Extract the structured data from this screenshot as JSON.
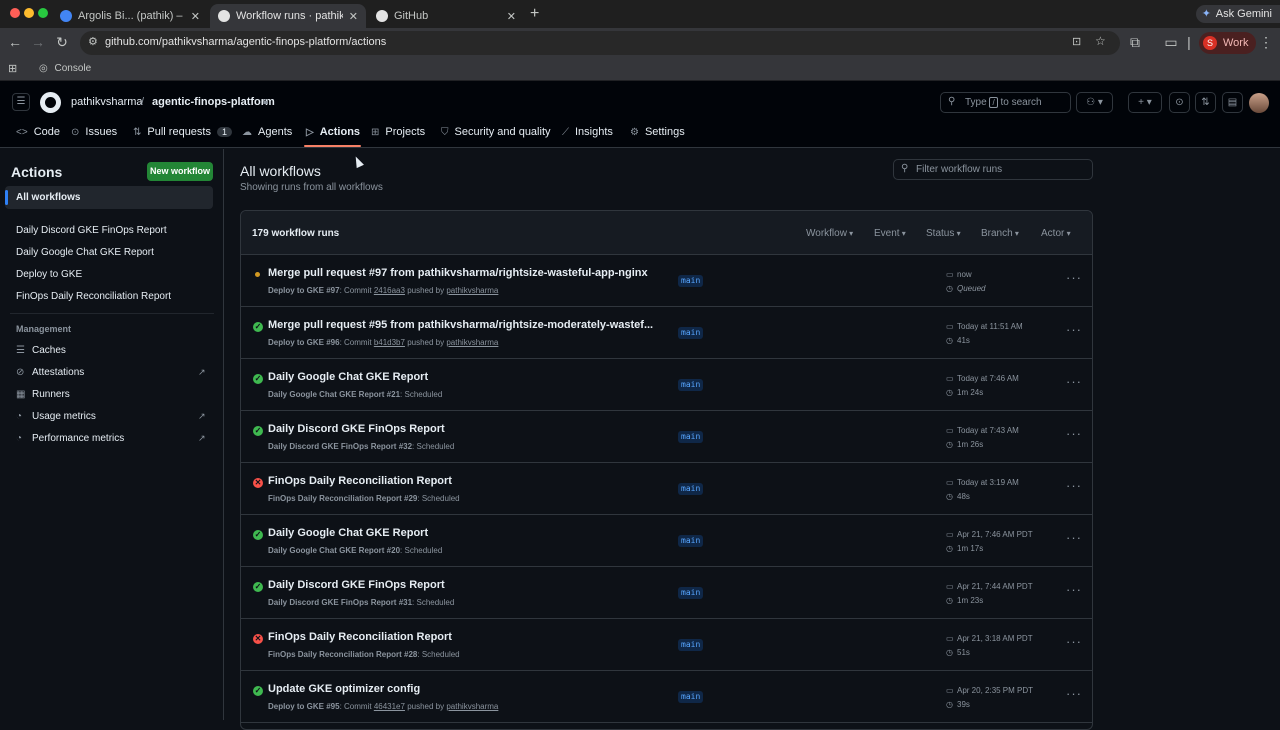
{
  "browser": {
    "tabs": [
      {
        "label": "Argolis Bi... (pathik) – Budget"
      },
      {
        "label": "Workflow runs · pathikvsharm"
      },
      {
        "label": "GitHub"
      }
    ],
    "new_tab": "+",
    "ask_gemini": "Ask Gemini",
    "url": "github.com/pathikvsharma/agentic-finops-platform/actions",
    "profile_initial": "S",
    "profile_label": "Work",
    "bookmarks": [
      {
        "label": "Console"
      }
    ],
    "colors": {
      "close": "#ff5f57",
      "minimize": "#febc2e",
      "zoom": "#28c840"
    }
  },
  "github": {
    "owner": "pathikvsharma",
    "separator": "/",
    "repo": "agentic-finops-platform",
    "search_prefix": "Type",
    "search_key": "/",
    "search_suffix": "to search",
    "nav": [
      {
        "label": "Code"
      },
      {
        "label": "Issues"
      },
      {
        "label": "Pull requests",
        "count": "1"
      },
      {
        "label": "Agents"
      },
      {
        "label": "Actions"
      },
      {
        "label": "Projects"
      },
      {
        "label": "Security and quality"
      },
      {
        "label": "Insights"
      },
      {
        "label": "Settings"
      }
    ]
  },
  "sidebar": {
    "title": "Actions",
    "new_workflow": "New workflow",
    "all_workflows": "All workflows",
    "workflows": [
      {
        "label": "Daily Discord GKE FinOps Report"
      },
      {
        "label": "Daily Google Chat GKE Report"
      },
      {
        "label": "Deploy to GKE"
      },
      {
        "label": "FinOps Daily Reconciliation Report"
      }
    ],
    "management_title": "Management",
    "management": [
      {
        "label": "Caches"
      },
      {
        "label": "Attestations"
      },
      {
        "label": "Runners"
      },
      {
        "label": "Usage metrics"
      },
      {
        "label": "Performance metrics"
      }
    ]
  },
  "main": {
    "title": "All workflows",
    "subtitle": "Showing runs from all workflows",
    "filter_placeholder": "Filter workflow runs",
    "runs_count": "179 workflow runs",
    "filters": [
      {
        "label": "Workflow"
      },
      {
        "label": "Event"
      },
      {
        "label": "Status"
      },
      {
        "label": "Branch"
      },
      {
        "label": "Actor"
      }
    ],
    "runs": [
      {
        "status": "queued",
        "title": "Merge pull request #97 from pathikvsharma/rightsize-wasteful-app-nginx",
        "workflow_run": "Deploy to GKE #97",
        "sep": ": Commit ",
        "commit": "2416aa3",
        "mid": " pushed by ",
        "actor": "pathikvsharma",
        "branch": "main",
        "time": "now",
        "duration": "Queued"
      },
      {
        "status": "success",
        "title": "Merge pull request #95 from pathikvsharma/rightsize-moderately-wastef...",
        "workflow_run": "Deploy to GKE #96",
        "sep": ": Commit ",
        "commit": "b41d3b7",
        "mid": " pushed by ",
        "actor": "pathikvsharma",
        "branch": "main",
        "time": "Today at 11:51 AM",
        "duration": "41s"
      },
      {
        "status": "success",
        "title": "Daily Google Chat GKE Report",
        "workflow_run": "Daily Google Chat GKE Report #21",
        "sep": ": Scheduled",
        "commit": "",
        "mid": "",
        "actor": "",
        "branch": "main",
        "time": "Today at 7:46 AM",
        "duration": "1m 24s"
      },
      {
        "status": "success",
        "title": "Daily Discord GKE FinOps Report",
        "workflow_run": "Daily Discord GKE FinOps Report #32",
        "sep": ": Scheduled",
        "commit": "",
        "mid": "",
        "actor": "",
        "branch": "main",
        "time": "Today at 7:43 AM",
        "duration": "1m 26s"
      },
      {
        "status": "failure",
        "title": "FinOps Daily Reconciliation Report",
        "workflow_run": "FinOps Daily Reconciliation Report #29",
        "sep": ": Scheduled",
        "commit": "",
        "mid": "",
        "actor": "",
        "branch": "main",
        "time": "Today at 3:19 AM",
        "duration": "48s"
      },
      {
        "status": "success",
        "title": "Daily Google Chat GKE Report",
        "workflow_run": "Daily Google Chat GKE Report #20",
        "sep": ": Scheduled",
        "commit": "",
        "mid": "",
        "actor": "",
        "branch": "main",
        "time": "Apr 21, 7:46 AM PDT",
        "duration": "1m 17s"
      },
      {
        "status": "success",
        "title": "Daily Discord GKE FinOps Report",
        "workflow_run": "Daily Discord GKE FinOps Report #31",
        "sep": ": Scheduled",
        "commit": "",
        "mid": "",
        "actor": "",
        "branch": "main",
        "time": "Apr 21, 7:44 AM PDT",
        "duration": "1m 23s"
      },
      {
        "status": "failure",
        "title": "FinOps Daily Reconciliation Report",
        "workflow_run": "FinOps Daily Reconciliation Report #28",
        "sep": ": Scheduled",
        "commit": "",
        "mid": "",
        "actor": "",
        "branch": "main",
        "time": "Apr 21, 3:18 AM PDT",
        "duration": "51s"
      },
      {
        "status": "success",
        "title": "Update GKE optimizer config",
        "workflow_run": "Deploy to GKE #95",
        "sep": ": Commit ",
        "commit": "46431e7",
        "mid": " pushed by ",
        "actor": "pathikvsharma",
        "branch": "main",
        "time": "Apr 20, 2:35 PM PDT",
        "duration": "39s"
      }
    ]
  }
}
